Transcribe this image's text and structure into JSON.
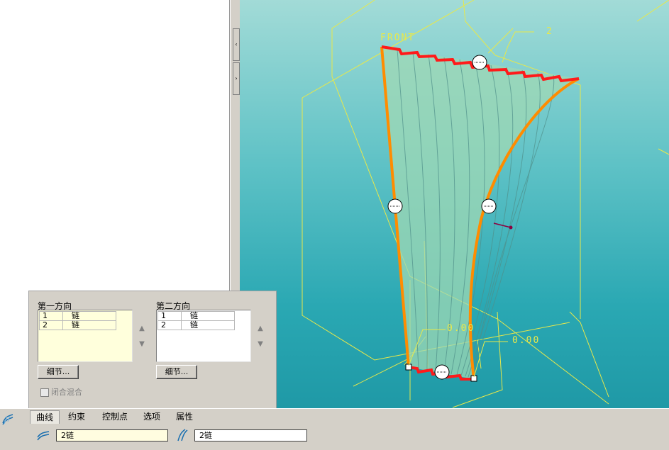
{
  "viewport": {
    "front_label": "FRONT",
    "dim_label_top": "2",
    "dim_label_a": "0.00",
    "dim_label_b": "0.00"
  },
  "panel": {
    "first_direction": {
      "title": "第一方向",
      "rows": [
        {
          "index": "1",
          "value": "链"
        },
        {
          "index": "2",
          "value": "链"
        }
      ],
      "details_button": "细节..."
    },
    "second_direction": {
      "title": "第二方向",
      "rows": [
        {
          "index": "1",
          "value": "链"
        },
        {
          "index": "2",
          "value": "链"
        }
      ],
      "details_button": "细节..."
    },
    "closed_blend_label": "闭合混合"
  },
  "dashboard": {
    "tabs": [
      "曲线",
      "约束",
      "控制点",
      "选项",
      "属性"
    ],
    "first_field_value": "2链",
    "second_field_value": "2链"
  },
  "colors": {
    "edge_orange": "#ff8c00",
    "edge_red": "#ff1a1a",
    "bbox_yellow": "#e8e84a",
    "panel_list_bg": "#ffffdc"
  }
}
